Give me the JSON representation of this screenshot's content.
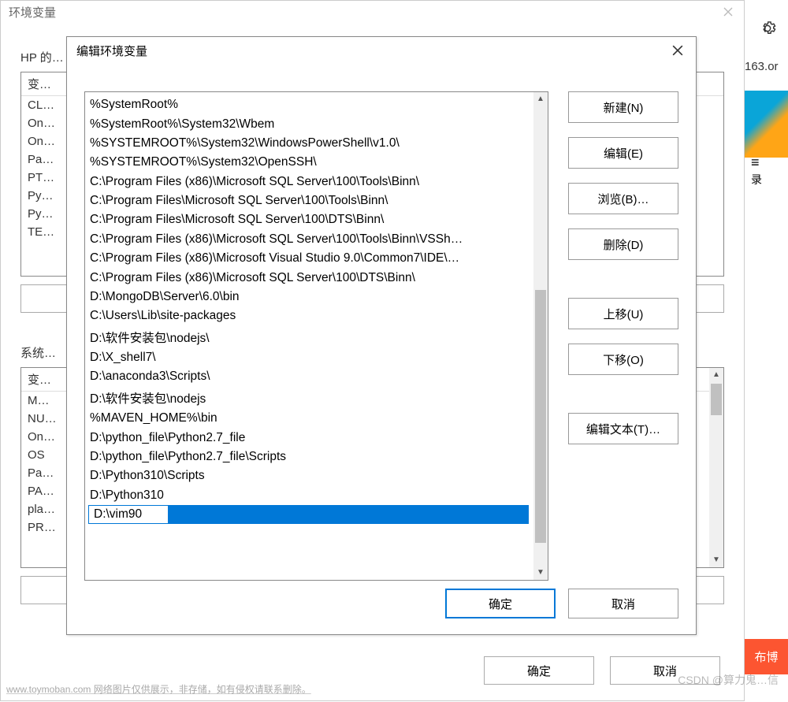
{
  "parent_dialog": {
    "title": "环境变量",
    "user_section_label": "HP 的…",
    "sys_section_label": "系统…",
    "header_col0": "变…",
    "user_vars": [
      "CL…",
      "On…",
      "On…",
      "Pa…",
      "PT…",
      "Py…",
      "Py…",
      "TE…"
    ],
    "sys_vars": [
      "M…",
      "NU…",
      "On…",
      "OS",
      "Pa…",
      "PA…",
      "pla…",
      "PR…"
    ],
    "ok": "确定",
    "cancel": "取消"
  },
  "child_dialog": {
    "title": "编辑环境变量",
    "paths": [
      "%SystemRoot%",
      "%SystemRoot%\\System32\\Wbem",
      "%SYSTEMROOT%\\System32\\WindowsPowerShell\\v1.0\\",
      "%SYSTEMROOT%\\System32\\OpenSSH\\",
      "C:\\Program Files (x86)\\Microsoft SQL Server\\100\\Tools\\Binn\\",
      "C:\\Program Files\\Microsoft SQL Server\\100\\Tools\\Binn\\",
      "C:\\Program Files\\Microsoft SQL Server\\100\\DTS\\Binn\\",
      "C:\\Program Files (x86)\\Microsoft SQL Server\\100\\Tools\\Binn\\VSSh…",
      "C:\\Program Files (x86)\\Microsoft Visual Studio 9.0\\Common7\\IDE\\…",
      "C:\\Program Files (x86)\\Microsoft SQL Server\\100\\DTS\\Binn\\",
      "D:\\MongoDB\\Server\\6.0\\bin",
      "C:\\Users\\Lib\\site-packages",
      "D:\\软件安装包\\nodejs\\",
      "D:\\X_shell7\\",
      "D:\\anaconda3\\Scripts\\",
      "D:\\软件安装包\\nodejs",
      "%MAVEN_HOME%\\bin",
      "D:\\python_file\\Python2.7_file",
      "D:\\python_file\\Python2.7_file\\Scripts",
      "D:\\Python310\\Scripts",
      "D:\\Python310"
    ],
    "editing_value": "D:\\vim90",
    "buttons": {
      "new": "新建(N)",
      "edit": "编辑(E)",
      "browse": "浏览(B)…",
      "delete": "删除(D)",
      "move_up": "上移(U)",
      "move_down": "下移(O)",
      "edit_text": "编辑文本(T)…"
    },
    "ok": "确定",
    "cancel": "取消"
  },
  "right_sliver": {
    "url": "163.or",
    "lu": "录"
  },
  "watermarks": {
    "csdn": "CSDN @算力鬼…信",
    "bottom": "www.toymoban.com 网络图片仅供展示，非存储，如有侵权请联系删除。"
  }
}
